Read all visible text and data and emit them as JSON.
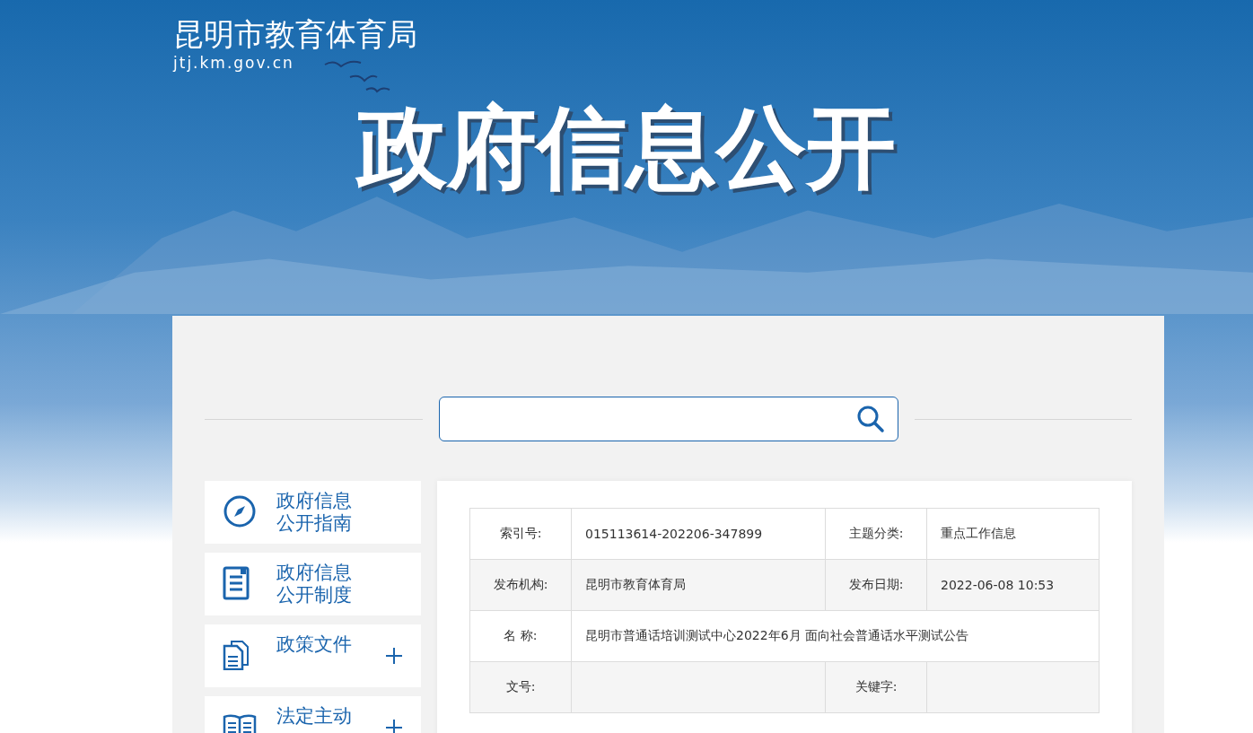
{
  "site": {
    "title": "昆明市教育体育局",
    "domain": "jtj.km.gov.cn"
  },
  "banner": {
    "title": "政府信息公开"
  },
  "sidebar": {
    "items": [
      {
        "kind": "compass",
        "lines": [
          "政府信息",
          "公开指南"
        ],
        "expandable": false
      },
      {
        "kind": "document",
        "lines": [
          "政府信息",
          "公开制度"
        ],
        "expandable": false
      },
      {
        "kind": "files",
        "lines": [
          "政策文件"
        ],
        "expandable": true
      },
      {
        "kind": "book",
        "lines": [
          "法定主动"
        ],
        "expandable": true
      }
    ]
  },
  "info_table": {
    "rows": [
      {
        "cells": [
          {
            "label": "索引号:",
            "value": "015113614-202206-347899"
          },
          {
            "label": "主题分类:",
            "value": "重点工作信息"
          }
        ]
      },
      {
        "cells": [
          {
            "label": "发布机构:",
            "value": "昆明市教育体育局"
          },
          {
            "label": "发布日期:",
            "value": "2022-06-08 10:53"
          }
        ]
      },
      {
        "cells": [
          {
            "label": "名 称:",
            "value": "昆明市普通话培训测试中心2022年6月 面向社会普通话水平测试公告"
          }
        ]
      },
      {
        "cells": [
          {
            "label": "文号:"
          },
          {
            "label": "关键字:"
          }
        ]
      }
    ]
  }
}
